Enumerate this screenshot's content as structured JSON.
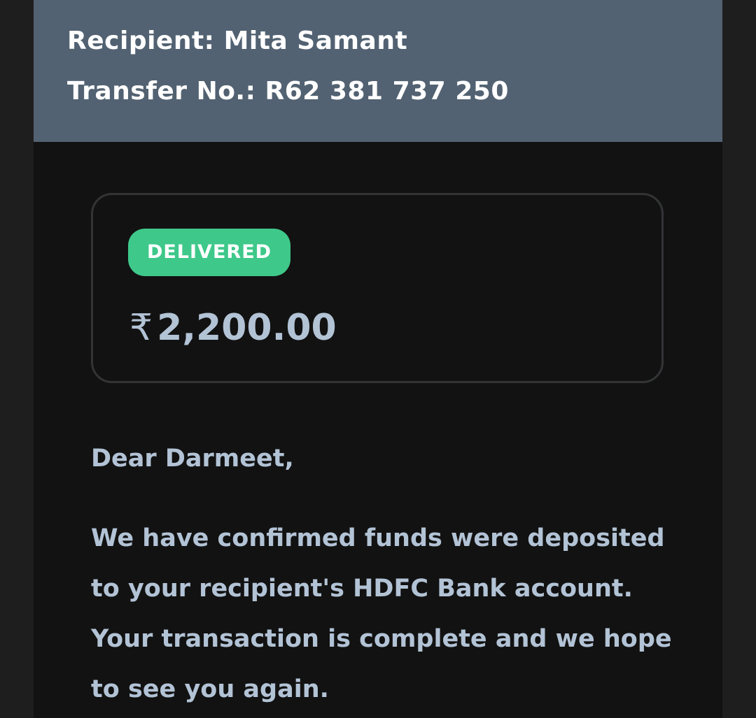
{
  "header": {
    "recipient": "Recipient: Mita Samant",
    "transfer_no": "Transfer No.: R62 381 737 250"
  },
  "status": {
    "label": "DELIVERED",
    "color": "#3ec88a"
  },
  "amount": {
    "currency_symbol": "₹",
    "value": "2,200.00"
  },
  "message": {
    "greeting": "Dear Darmeet,",
    "body": "We have confirmed funds were deposited to your recipient's HDFC Bank account. Your transaction is complete and we hope to see you again."
  }
}
